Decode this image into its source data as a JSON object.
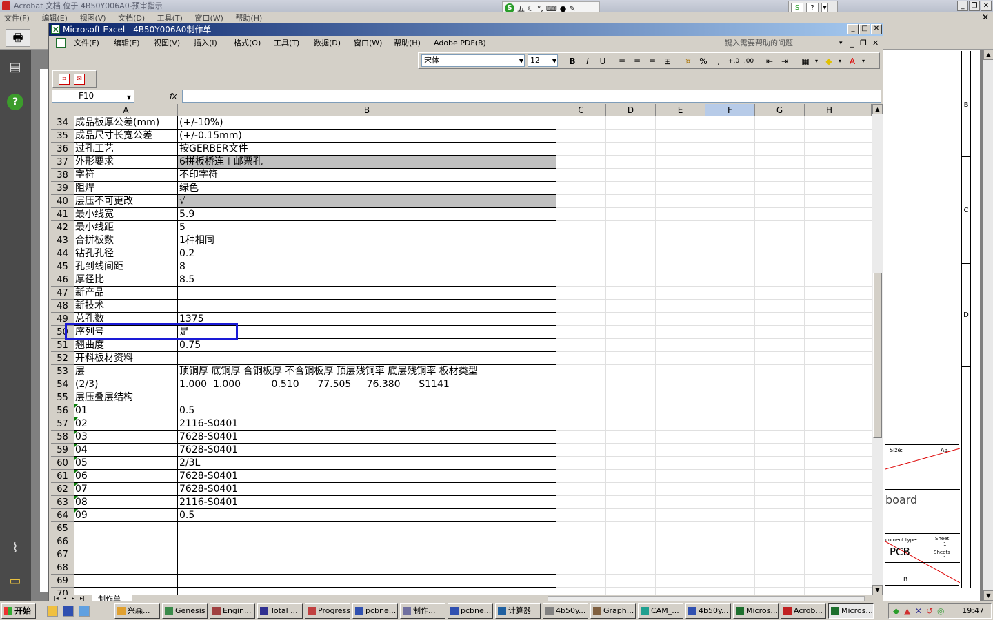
{
  "acrobat": {
    "title": "Acrobat 文档 位于 4B50Y006A0-预审指示",
    "menu": [
      "文件(F)",
      "编辑(E)",
      "视图(V)",
      "文档(D)",
      "工具(T)",
      "窗口(W)",
      "帮助(H)"
    ]
  },
  "ime": {
    "mode": "五"
  },
  "excel": {
    "title": "Microsoft Excel - 4B50Y006A0制作单",
    "menu": [
      "文件(F)",
      "编辑(E)",
      "视图(V)",
      "插入(I)",
      "格式(O)",
      "工具(T)",
      "数据(D)",
      "窗口(W)",
      "帮助(H)",
      "Adobe PDF(B)"
    ],
    "help_placeholder": "键入需要帮助的问题",
    "font_name": "宋体",
    "font_size": "12",
    "name_box": "F10",
    "fx_label": "fx",
    "columns": [
      "A",
      "B",
      "C",
      "D",
      "E",
      "F",
      "G",
      "H"
    ],
    "selected_column": "F",
    "sheet_tab": "制作单",
    "rows": [
      {
        "n": "34",
        "a": "成品板厚公差(mm)",
        "b": "(+/-10%)"
      },
      {
        "n": "35",
        "a": "成品尺寸长宽公差",
        "b": "(+/-0.15mm)"
      },
      {
        "n": "36",
        "a": "过孔工艺",
        "b": "按GERBER文件"
      },
      {
        "n": "37",
        "a": "外形要求",
        "b": "6拼板桥连＋邮票孔",
        "shaded": true
      },
      {
        "n": "38",
        "a": "字符",
        "b": "不印字符"
      },
      {
        "n": "39",
        "a": "阻焊",
        "b": "绿色"
      },
      {
        "n": "40",
        "a": "层压不可更改",
        "b": "√",
        "shaded": true
      },
      {
        "n": "41",
        "a": "最小线宽",
        "b": "5.9"
      },
      {
        "n": "42",
        "a": "最小线距",
        "b": "5"
      },
      {
        "n": "43",
        "a": "合拼板数",
        "b": "1种相同"
      },
      {
        "n": "44",
        "a": "钻孔孔径",
        "b": "0.2"
      },
      {
        "n": "45",
        "a": "孔到线间距",
        "b": "8"
      },
      {
        "n": "46",
        "a": "厚径比",
        "b": "8.5"
      },
      {
        "n": "47",
        "a": "新产品",
        "b": ""
      },
      {
        "n": "48",
        "a": "新技术",
        "b": ""
      },
      {
        "n": "49",
        "a": "总孔数",
        "b": "1375"
      },
      {
        "n": "50",
        "a": "序列号",
        "b": "是"
      },
      {
        "n": "51",
        "a": "翘曲度",
        "b": "0.75"
      },
      {
        "n": "52",
        "a": "开料板材资料",
        "b": ""
      },
      {
        "n": "53",
        "a": "层",
        "b": "顶铜厚 底铜厚 含铜板厚 不含铜板厚 顶层残铜率 底层残铜率 板材类型"
      },
      {
        "n": "54",
        "a": "(2/3)",
        "b": "1.000  1.000          0.510      77.505     76.380      S1141"
      },
      {
        "n": "55",
        "a": "层压叠层结构",
        "b": ""
      },
      {
        "n": "56",
        "a": "01",
        "b": "0.5",
        "tri": true
      },
      {
        "n": "57",
        "a": "02",
        "b": "2116-S0401",
        "tri": true
      },
      {
        "n": "58",
        "a": "03",
        "b": "7628-S0401",
        "tri": true
      },
      {
        "n": "59",
        "a": "04",
        "b": "7628-S0401",
        "tri": true
      },
      {
        "n": "60",
        "a": "05",
        "b": "2/3L",
        "tri": true
      },
      {
        "n": "61",
        "a": "06",
        "b": "7628-S0401",
        "tri": true
      },
      {
        "n": "62",
        "a": "07",
        "b": "7628-S0401",
        "tri": true
      },
      {
        "n": "63",
        "a": "08",
        "b": "2116-S0401",
        "tri": true
      },
      {
        "n": "64",
        "a": "09",
        "b": "0.5",
        "tri": true
      },
      {
        "n": "65",
        "a": "",
        "b": ""
      },
      {
        "n": "66",
        "a": "",
        "b": ""
      },
      {
        "n": "67",
        "a": "",
        "b": ""
      },
      {
        "n": "68",
        "a": "",
        "b": ""
      },
      {
        "n": "69",
        "a": "",
        "b": ""
      },
      {
        "n": "70",
        "a": "",
        "b": ""
      }
    ]
  },
  "drawing": {
    "zone_labels": [
      "B",
      "C",
      "D"
    ],
    "size_label": "Size:",
    "size_value": "A3",
    "title_fragment": "board",
    "doc_type_label": "cument type:",
    "doc_type_value": "PCB",
    "sheet_label": "Sheet",
    "sheet_value": "1",
    "sheets_label": "Sheets",
    "sheets_value": "1",
    "bottom_zone": "B"
  },
  "taskbar": {
    "start": "开始",
    "tasks": [
      {
        "label": "兴森...",
        "color": "#e0a030"
      },
      {
        "label": "Genesis",
        "color": "#3a8a4a"
      },
      {
        "label": "Engin...",
        "color": "#a04040"
      },
      {
        "label": "Total ...",
        "color": "#303090"
      },
      {
        "label": "Progress",
        "color": "#c04040"
      },
      {
        "label": "pcbne...",
        "color": "#3050b0"
      },
      {
        "label": "制作...",
        "color": "#7070a0"
      },
      {
        "label": "pcbne...",
        "color": "#3050b0"
      },
      {
        "label": "计算器",
        "color": "#2060a0"
      },
      {
        "label": "4b50y...",
        "color": "#808080"
      },
      {
        "label": "Graph...",
        "color": "#806040"
      },
      {
        "label": "CAM_...",
        "color": "#20a090"
      },
      {
        "label": "4b50y...",
        "color": "#3050b0"
      },
      {
        "label": "Micros...",
        "color": "#1d6f2d"
      },
      {
        "label": "Acrob...",
        "color": "#c02020"
      },
      {
        "label": "Micros...",
        "color": "#1d6f2d"
      }
    ],
    "clock": "19:47"
  }
}
